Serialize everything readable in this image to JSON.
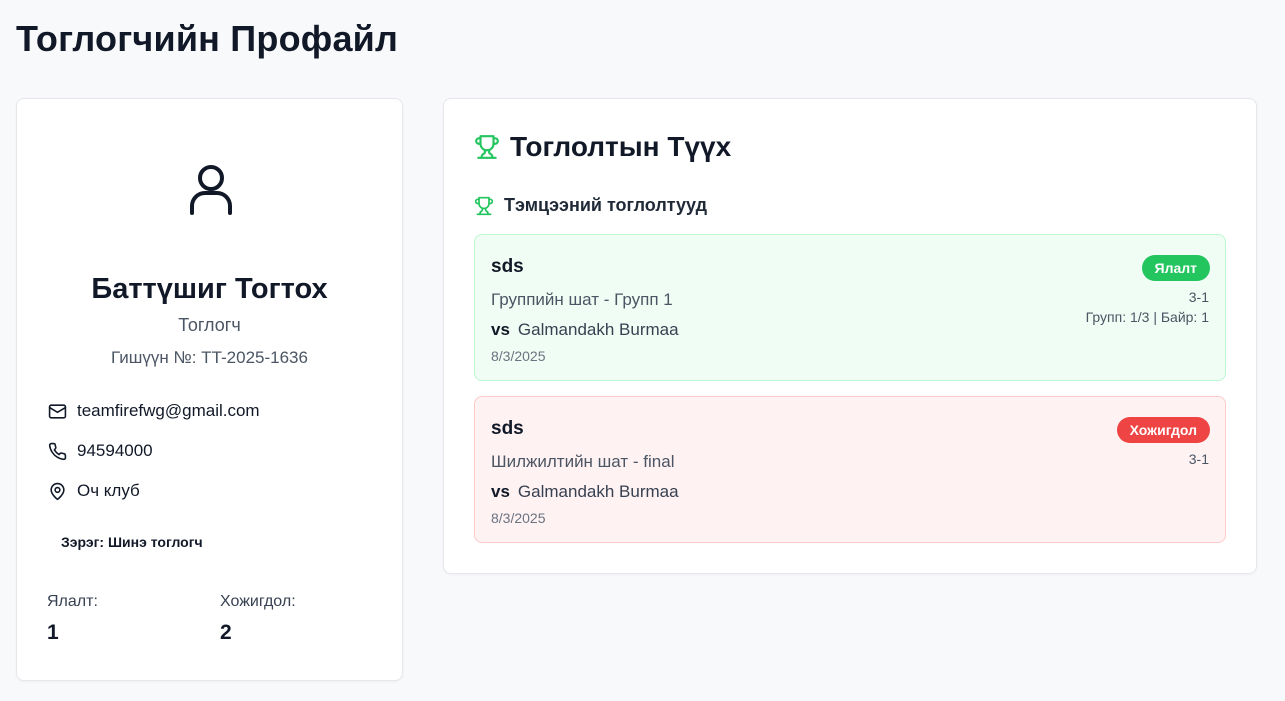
{
  "page": {
    "title": "Тоглогчийн Профайл"
  },
  "profile": {
    "avatar_icon": "user-icon",
    "name": "Баттүшиг Тогтох",
    "role": "Тоглогч",
    "member_id": "Гишүүн №: TT-2025-1636",
    "email": "teamfirefwg@gmail.com",
    "phone": "94594000",
    "club": "Оч клуб",
    "rank": "Зэрэг: Шинэ тоглогч",
    "stats": {
      "wins_label": "Ялалт:",
      "wins_value": "1",
      "losses_label": "Хожигдол:",
      "losses_value": "2"
    }
  },
  "history": {
    "title": "Тоглолтын Түүх",
    "section_title": "Тэмцээний тоглолтууд",
    "accent_color": "#22c55e",
    "matches": [
      {
        "name": "sds",
        "stage": "Группийн шат - Групп 1",
        "vs_label": "vs",
        "opponent": "Galmandakh Burmaa",
        "date": "8/3/2025",
        "result": "Ялалт",
        "result_color": "#22c55e",
        "score": "3-1",
        "group_info": "Групп: 1/3 | Байр: 1"
      },
      {
        "name": "sds",
        "stage": "Шилжилтийн шат - final",
        "vs_label": "vs",
        "opponent": "Galmandakh Burmaa",
        "date": "8/3/2025",
        "result": "Хожигдол",
        "result_color": "#ef4444",
        "score": "3-1"
      }
    ]
  }
}
